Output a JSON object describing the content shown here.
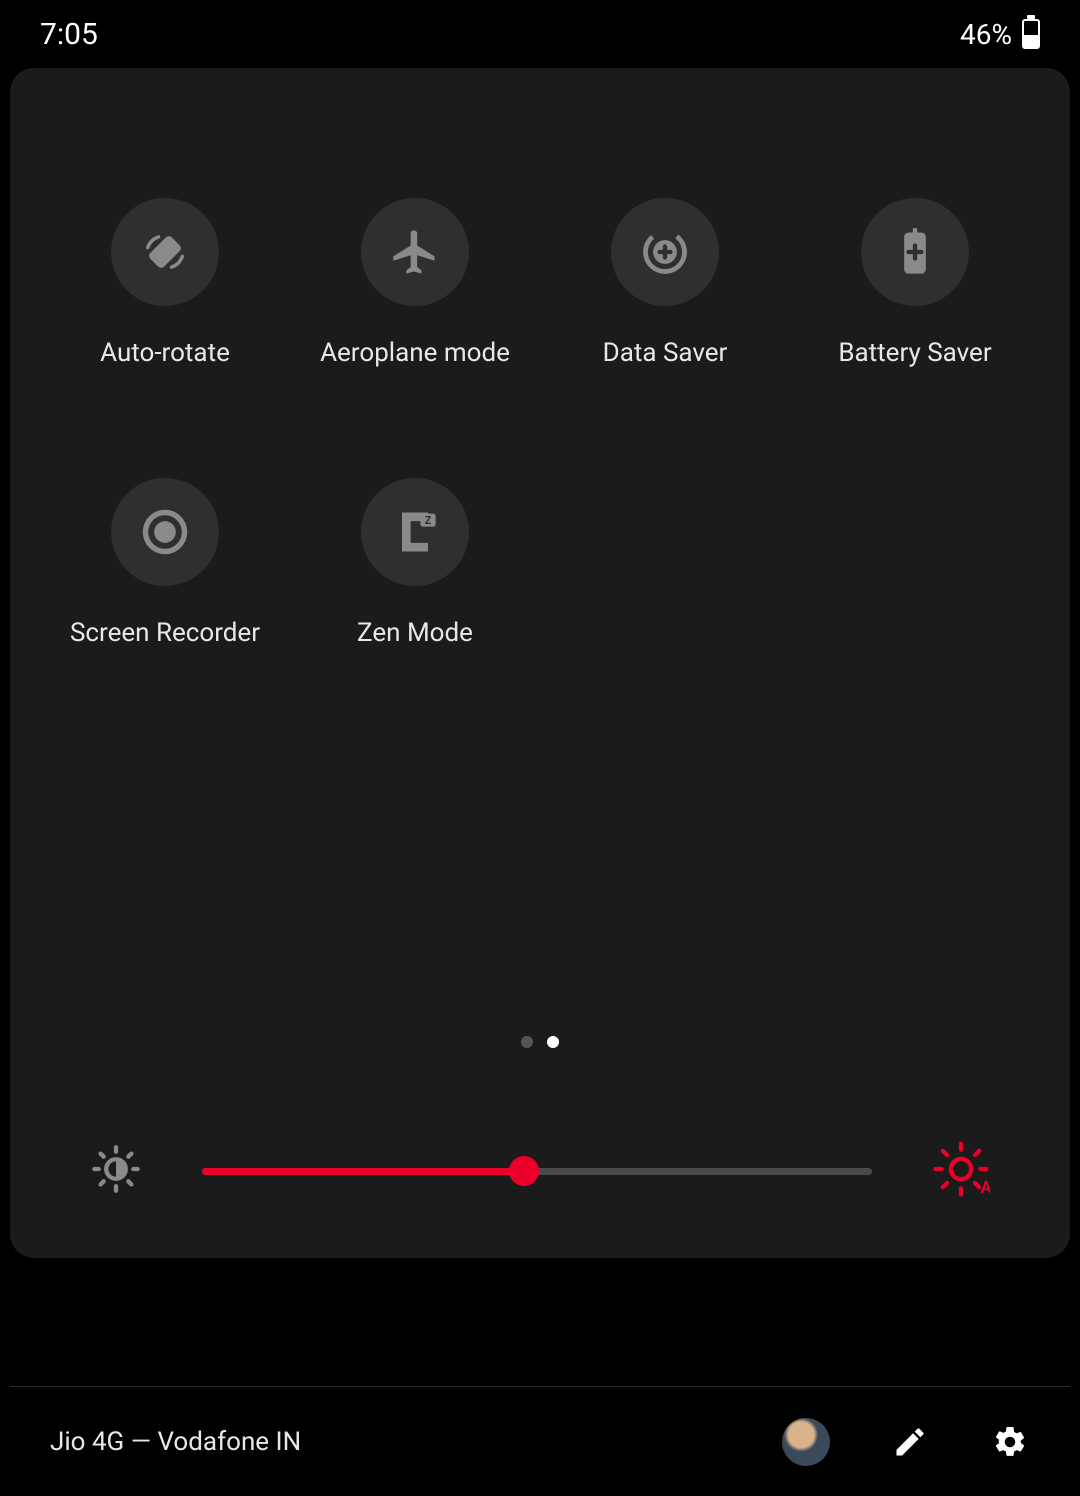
{
  "status": {
    "time": "7:05",
    "battery_pct_label": "46%",
    "battery_pct": 46
  },
  "tiles": [
    {
      "id": "auto-rotate",
      "label": "Auto-rotate"
    },
    {
      "id": "aeroplane-mode",
      "label": "Aeroplane mode"
    },
    {
      "id": "data-saver",
      "label": "Data Saver"
    },
    {
      "id": "battery-saver",
      "label": "Battery Saver"
    },
    {
      "id": "screen-recorder",
      "label": "Screen Recorder"
    },
    {
      "id": "zen-mode",
      "label": "Zen Mode"
    }
  ],
  "pagination": {
    "total": 2,
    "active_index": 1
  },
  "brightness": {
    "percent": 48
  },
  "footer": {
    "carrier_text": "Jio 4G — Vodafone IN"
  },
  "colors": {
    "accent": "#eb0029",
    "panel_bg": "#1b1b1b",
    "tile_bg": "#2f2f2f"
  }
}
